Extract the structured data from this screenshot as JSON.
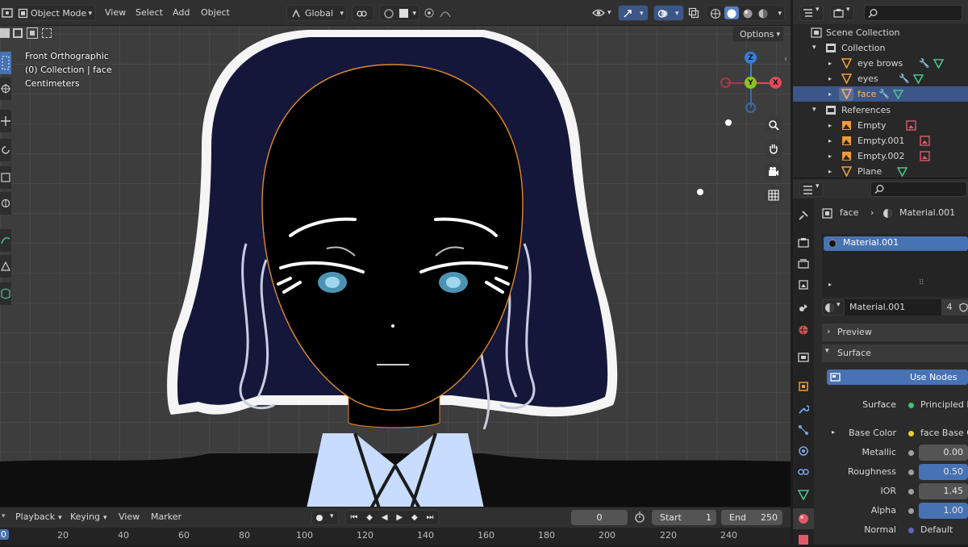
{
  "header": {
    "mode": "Object Mode",
    "menu": [
      "View",
      "Select",
      "Add",
      "Object"
    ],
    "orientation": "Global",
    "options": "Options"
  },
  "viewport": {
    "info_view": "Front Orthographic",
    "info_collection": "(0) Collection | face",
    "info_units": "Centimeters"
  },
  "outliner": {
    "rows": [
      {
        "label": "Scene Collection",
        "type": "scene"
      },
      {
        "label": "Collection",
        "type": "collection"
      },
      {
        "label": "eye brows",
        "type": "mesh"
      },
      {
        "label": "eyes",
        "type": "mesh"
      },
      {
        "label": "face",
        "type": "mesh",
        "selected": true
      },
      {
        "label": "References",
        "type": "collection"
      },
      {
        "label": "Empty",
        "type": "empty"
      },
      {
        "label": "Empty.001",
        "type": "empty"
      },
      {
        "label": "Empty.002",
        "type": "empty"
      },
      {
        "label": "Plane",
        "type": "mesh"
      }
    ]
  },
  "properties": {
    "breadcrumb_object": "face",
    "breadcrumb_material": "Material.001",
    "slot_name": "Material.001",
    "material_name": "Material.001",
    "user_count": "4",
    "panel_preview": "Preview",
    "panel_surface": "Surface",
    "use_nodes": "Use Nodes",
    "surface_label": "Surface",
    "surface_value": "Principled B",
    "base_color_label": "Base Color",
    "base_color_value": "face Base C",
    "metallic_label": "Metallic",
    "metallic_value": "0.00",
    "roughness_label": "Roughness",
    "roughness_value": "0.50",
    "ior_label": "IOR",
    "ior_value": "1.45",
    "alpha_label": "Alpha",
    "alpha_value": "1.00",
    "normal_label": "Normal",
    "normal_value": "Default"
  },
  "timeline": {
    "menu": [
      "Playback",
      "Keying",
      "View",
      "Marker"
    ],
    "current_frame": "0",
    "start_label": "Start",
    "start_value": "1",
    "end_label": "End",
    "end_value": "250",
    "ruler": [
      "0",
      "20",
      "40",
      "60",
      "80",
      "100",
      "120",
      "140",
      "160",
      "180",
      "200",
      "220",
      "240"
    ]
  },
  "colors": {
    "accent": "#4772b3",
    "selection": "#3b5689",
    "hair": "#15173a",
    "iris": "#4c93b3",
    "outline": "#e08a2a"
  }
}
